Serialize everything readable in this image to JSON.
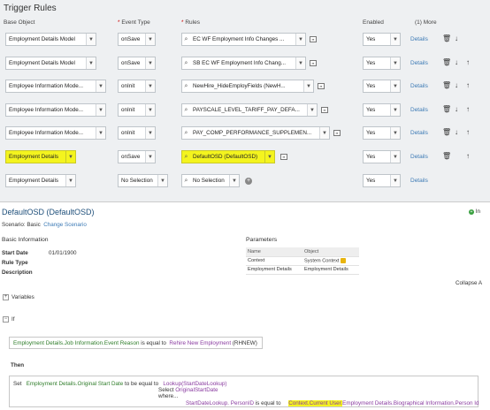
{
  "title": "Trigger Rules",
  "headers": {
    "base_object": "Base Object",
    "event_type": "Event Type",
    "rules": "Rules",
    "enabled": "Enabled",
    "more": "(1) More",
    "required_mark": "*"
  },
  "rows": [
    {
      "base": "Employment Details Model",
      "event": "onSave",
      "rule": "EC WF Employment Info Changes ...",
      "enabled": "Yes",
      "details": "Details",
      "icons": [
        "trash-icon",
        "arrow-down-icon"
      ]
    },
    {
      "base": "Employment Details Model",
      "event": "onSave",
      "rule": "SB EC WF Employment Info Chang...",
      "enabled": "Yes",
      "details": "Details",
      "icons": [
        "trash-icon",
        "arrow-down-icon",
        "arrow-up-icon"
      ]
    },
    {
      "base": "Employee Information Mode...",
      "event": "onInit",
      "rule": "NewHire_HideEmployFields (NewH...",
      "enabled": "Yes",
      "details": "Details",
      "icons": [
        "trash-icon",
        "arrow-down-icon",
        "arrow-up-icon"
      ]
    },
    {
      "base": "Employee Information Mode...",
      "event": "onInit",
      "rule": "PAYSCALE_LEVEL_TARIFF_PAY_DEFA...",
      "enabled": "Yes",
      "details": "Details",
      "icons": [
        "trash-icon",
        "arrow-down-icon",
        "arrow-up-icon"
      ]
    },
    {
      "base": "Employee Information Mode...",
      "event": "onInit",
      "rule": "PAY_COMP_PERFORMANCE_SUPPLEMEN...",
      "enabled": "Yes",
      "details": "Details",
      "icons": [
        "trash-icon",
        "arrow-down-icon",
        "arrow-up-icon"
      ]
    },
    {
      "base": "Employment Details",
      "event": "onSave",
      "rule": "DefaultOSD (DefaultOSD)",
      "enabled": "Yes",
      "details": "Details",
      "icons": [
        "trash-icon",
        "arrow-up-icon"
      ]
    },
    {
      "base": "Employment Details",
      "event": "No Selection",
      "rule": "No Selection",
      "enabled": "Yes",
      "details": "Details",
      "icons": []
    }
  ],
  "rule_detail": {
    "title": "DefaultOSD (DefaultOSD)",
    "in_label": "In",
    "scenario_label": "Scenario: Basic",
    "change_scenario": "Change Scenario",
    "basic_info_heading": "Basic Information",
    "start_date_label": "Start Date",
    "start_date_value": "01/01/1900",
    "rule_type_label": "Rule Type",
    "description_label": "Description",
    "parameters_heading": "Parameters",
    "param_headers": [
      "Name",
      "Object"
    ],
    "params": [
      [
        "Context",
        "System Context"
      ],
      [
        "Employment Details",
        "Employment Details"
      ]
    ],
    "collapse_all": "Collapse A",
    "variables_label": "Variables",
    "if_label": "If",
    "if_condition": {
      "field": "Employment Details.Job Information.Event Reason",
      "op": "is equal to",
      "value": "Rehire New Employment",
      "code": "(RHNEW)"
    },
    "then_label": "Then",
    "then": {
      "set": "Set",
      "target": "Employment Details.Original Start Date",
      "op": "to be equal to",
      "lookup": "Lookup(StartDateLookup)",
      "select": "Select",
      "select_field": "OriginalStartDate",
      "where": "where...",
      "where_field": "StartDateLookup.",
      "where_field2": "PersonID",
      "where_op": "is equal to",
      "ctx": "Context.Current User.",
      "rest": "Employment Details.Biographical Information.Person Id"
    }
  },
  "colors": {
    "highlight": "#f4f41e",
    "link": "#3c7ab5",
    "green_text": "#2f7d2a",
    "purple_text": "#8a3ca0"
  }
}
